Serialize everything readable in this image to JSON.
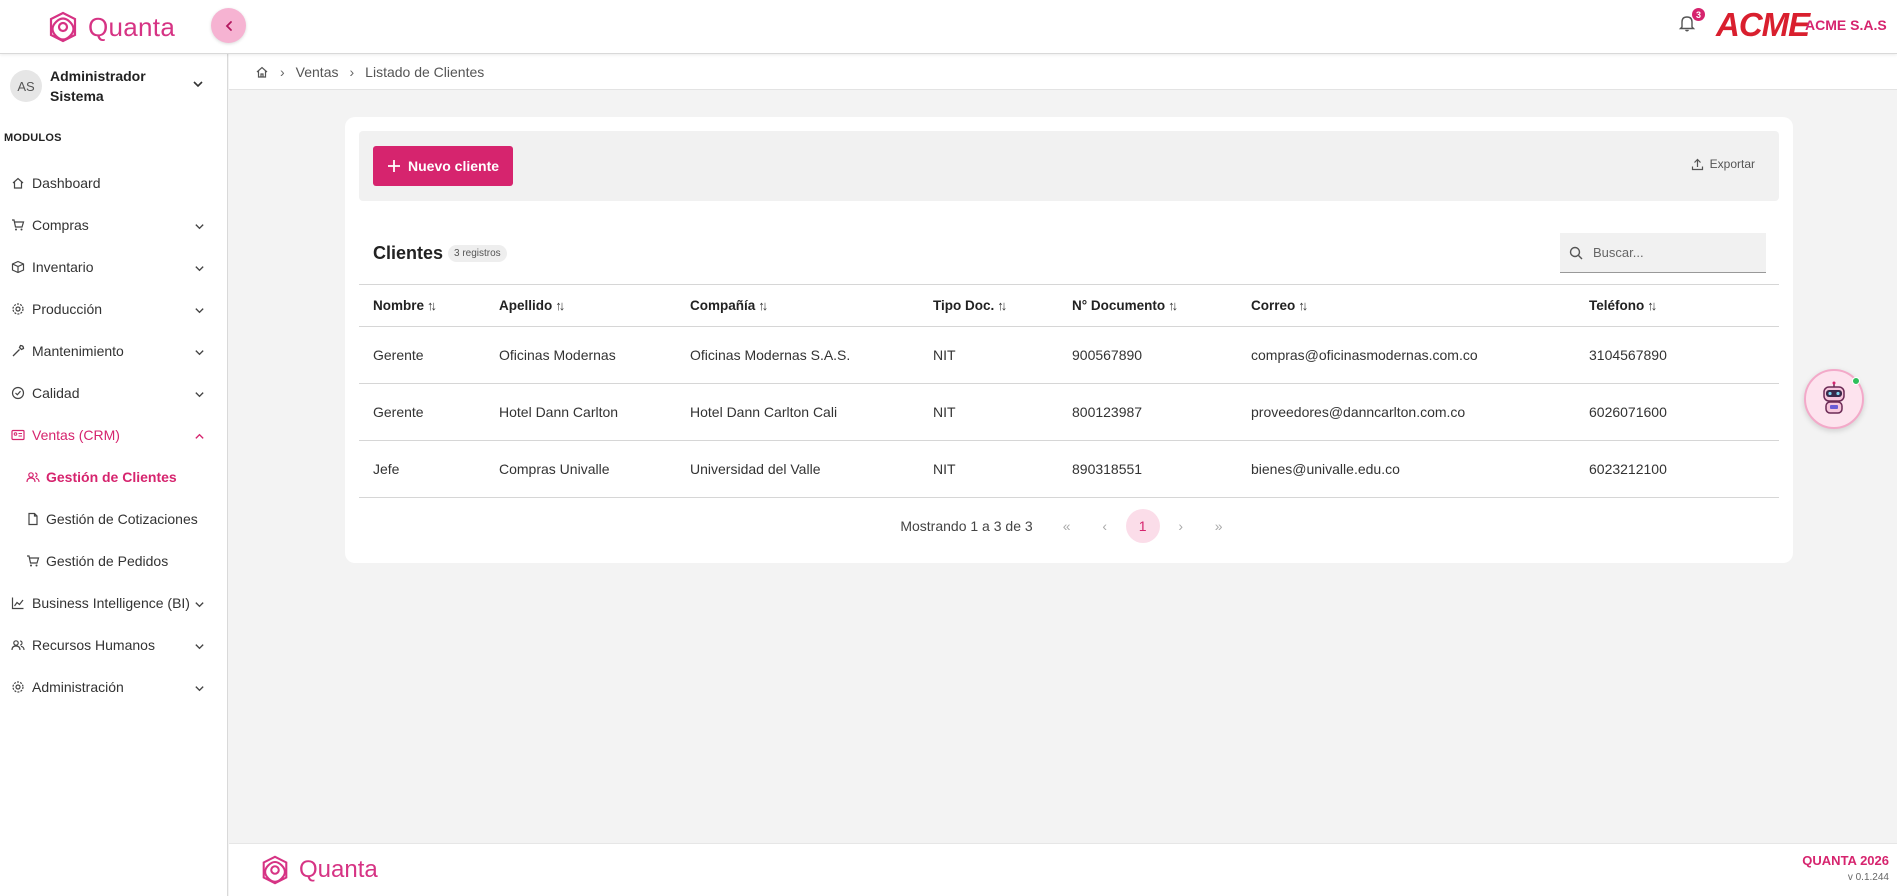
{
  "app": {
    "name": "Quanta",
    "company": "ACME S.A.S",
    "company_logo": "ACME",
    "notifications_count": "3",
    "accent_color": "#d6246e"
  },
  "user": {
    "initials": "AS",
    "name": "Administrador Sistema"
  },
  "sidebar": {
    "section_title": "MODULOS",
    "items": [
      {
        "label": "Dashboard",
        "icon": "home-icon",
        "chevron": false
      },
      {
        "label": "Compras",
        "icon": "cart-icon",
        "chevron": true
      },
      {
        "label": "Inventario",
        "icon": "box-icon",
        "chevron": true
      },
      {
        "label": "Producción",
        "icon": "gear-icon",
        "chevron": true
      },
      {
        "label": "Mantenimiento",
        "icon": "wrench-icon",
        "chevron": true
      },
      {
        "label": "Calidad",
        "icon": "check-circle-icon",
        "chevron": true
      },
      {
        "label": "Ventas (CRM)",
        "icon": "id-card-icon",
        "chevron": true,
        "expanded": true
      },
      {
        "label": "Gestión de Clientes",
        "icon": "users-icon",
        "sub": true,
        "current": true
      },
      {
        "label": "Gestión de Cotizaciones",
        "icon": "file-icon",
        "sub": true
      },
      {
        "label": "Gestión de Pedidos",
        "icon": "cart-icon",
        "sub": true
      },
      {
        "label": "Business Intelligence (BI)",
        "icon": "chart-icon",
        "chevron": true
      },
      {
        "label": "Recursos Humanos",
        "icon": "users-icon",
        "chevron": true
      },
      {
        "label": "Administración",
        "icon": "gear-icon",
        "chevron": true
      }
    ]
  },
  "breadcrumb": {
    "items": [
      "Ventas",
      "Listado de Clientes"
    ]
  },
  "toolbar": {
    "new_label": "Nuevo cliente",
    "export_label": "Exportar"
  },
  "table": {
    "title": "Clientes",
    "count_label": "3 registros",
    "search_placeholder": "Buscar...",
    "columns": [
      "Nombre",
      "Apellido",
      "Compañía",
      "Tipo Doc.",
      "N° Documento",
      "Correo",
      "Teléfono"
    ],
    "rows": [
      [
        "Gerente",
        "Oficinas Modernas",
        "Oficinas Modernas S.A.S.",
        "NIT",
        "900567890",
        "compras@oficinasmodernas.com.co",
        "3104567890"
      ],
      [
        "Gerente",
        "Hotel Dann Carlton",
        "Hotel Dann Carlton Cali",
        "NIT",
        "800123987",
        "proveedores@danncarlton.com.co",
        "6026071600"
      ],
      [
        "Jefe",
        "Compras Univalle",
        "Universidad del Valle",
        "NIT",
        "890318551",
        "bienes@univalle.edu.co",
        "6023212100"
      ]
    ]
  },
  "pagination": {
    "info": "Mostrando 1 a 3 de 3",
    "current_page": "1",
    "first": "«",
    "prev": "‹",
    "next": "›",
    "last": "»"
  },
  "footer": {
    "brand": "Quanta",
    "year_label": "QUANTA 2026",
    "version": "v 0.1.244"
  }
}
